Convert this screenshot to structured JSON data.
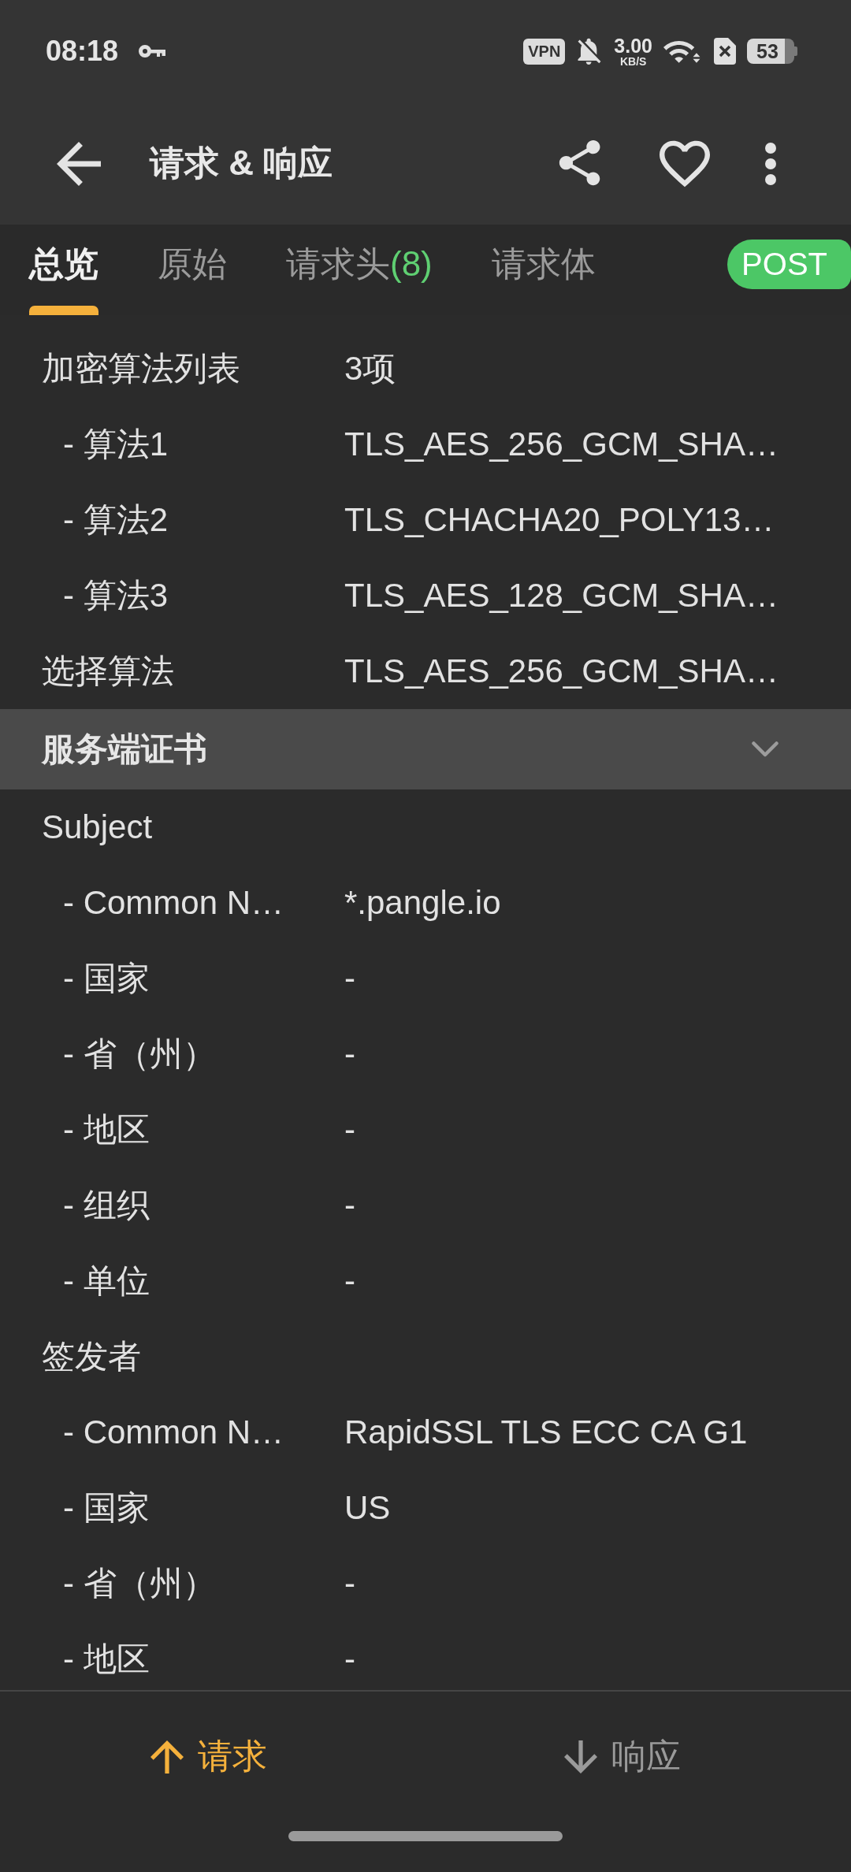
{
  "status_bar": {
    "time": "08:18",
    "vpn": "VPN",
    "net_speed": "3.00",
    "net_unit": "KB/S",
    "battery": "53"
  },
  "app_bar": {
    "title": "请求 & 响应"
  },
  "tabs": [
    {
      "label": "总览",
      "selected": true
    },
    {
      "label": "原始",
      "selected": false
    },
    {
      "label": "请求头",
      "count": "(8)",
      "selected": false
    },
    {
      "label": "请求体",
      "selected": false
    }
  ],
  "method": "POST",
  "sections": [
    {
      "rows": [
        {
          "label": "加密算法列表",
          "value": "3项",
          "children": [
            {
              "label": "- 算法1",
              "value": "TLS_AES_256_GCM_SHA…"
            },
            {
              "label": "- 算法2",
              "value": "TLS_CHACHA20_POLY13…"
            },
            {
              "label": "- 算法3",
              "value": "TLS_AES_128_GCM_SHA…"
            }
          ]
        },
        {
          "label": "选择算法",
          "value": "TLS_AES_256_GCM_SHA…"
        }
      ]
    },
    {
      "title": "服务端证书",
      "expanded": true,
      "rows": [
        {
          "label": "Subject",
          "children": [
            {
              "label": "- Common N…",
              "value": "*.pangle.io"
            },
            {
              "label": "- 国家",
              "value": "-"
            },
            {
              "label": "- 省（州）",
              "value": "-"
            },
            {
              "label": "- 地区",
              "value": "-"
            },
            {
              "label": "- 组织",
              "value": "-"
            },
            {
              "label": "- 单位",
              "value": "-"
            }
          ]
        },
        {
          "label": "签发者",
          "children": [
            {
              "label": "- Common N…",
              "value": "RapidSSL TLS ECC CA G1"
            },
            {
              "label": "- 国家",
              "value": "US"
            },
            {
              "label": "- 省（州）",
              "value": "-"
            },
            {
              "label": "- 地区",
              "value": "-"
            }
          ]
        }
      ]
    }
  ],
  "bottom_nav": [
    {
      "label": "请求",
      "kind": "up",
      "selected": true
    },
    {
      "label": "响应",
      "kind": "down",
      "selected": false
    }
  ]
}
